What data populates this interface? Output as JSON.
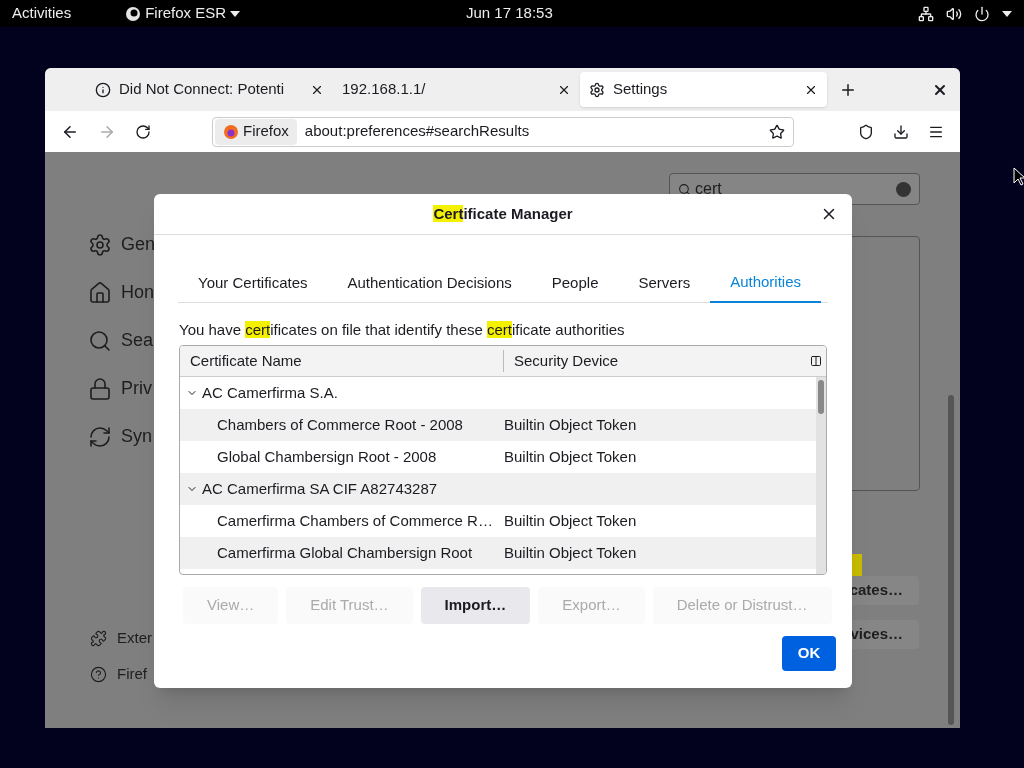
{
  "topbar": {
    "activities": "Activities",
    "app": "Firefox ESR",
    "clock": "Jun 17  18:53"
  },
  "browser": {
    "tabs": [
      {
        "title": "Did Not Connect: Potenti",
        "kind": "warning",
        "selected": false
      },
      {
        "title": "192.168.1.1/",
        "kind": "plain",
        "selected": false
      },
      {
        "title": "Settings",
        "kind": "settings",
        "selected": true
      }
    ],
    "identity": "Firefox",
    "url": "about:preferences#searchResults"
  },
  "settings": {
    "search": {
      "value": "cert"
    },
    "sidebar": [
      {
        "label": "Gen",
        "kind": "gear"
      },
      {
        "label": "Hon",
        "kind": "home"
      },
      {
        "label": "Sea",
        "kind": "search"
      },
      {
        "label": "Priv",
        "kind": "lock"
      },
      {
        "label": "Syn",
        "kind": "sync"
      }
    ],
    "footer": [
      {
        "label": "Exter",
        "kind": "puzzle"
      },
      {
        "label": "Firef",
        "kind": "help"
      }
    ],
    "buttons": [
      "cates…",
      "vices…"
    ]
  },
  "dialog": {
    "title": [
      {
        "text": "Cert",
        "highlight": true
      },
      {
        "text": "ificate Manager",
        "highlight": false
      }
    ],
    "tabs": [
      {
        "label": "Your Certificates",
        "selected": false
      },
      {
        "label": "Authentication Decisions",
        "selected": false
      },
      {
        "label": "People",
        "selected": false
      },
      {
        "label": "Servers",
        "selected": false
      },
      {
        "label": "Authorities",
        "selected": true
      }
    ],
    "description": [
      {
        "text": "You have ",
        "highlight": false
      },
      {
        "text": "cert",
        "highlight": true
      },
      {
        "text": "ificates on file that identify these ",
        "highlight": false
      },
      {
        "text": "cert",
        "highlight": true
      },
      {
        "text": "ificate authorities",
        "highlight": false
      }
    ],
    "columns": [
      "Certificate Name",
      "Security Device"
    ],
    "tree": [
      {
        "name": "AC Camerfirma S.A.",
        "expanded": true,
        "children": [
          {
            "name": "Chambers of Commerce Root - 2008",
            "device": "Builtin Object Token"
          },
          {
            "name": "Global Chambersign Root - 2008",
            "device": "Builtin Object Token"
          }
        ]
      },
      {
        "name": "AC Camerfirma SA CIF A82743287",
        "expanded": true,
        "children": [
          {
            "name": "Camerfirma Chambers of Commerce R…",
            "device": "Builtin Object Token"
          },
          {
            "name": "Camerfirma Global Chambersign Root",
            "device": "Builtin Object Token"
          }
        ]
      }
    ],
    "buttons": [
      {
        "label": "View…",
        "disabled": true
      },
      {
        "label": "Edit Trust…",
        "disabled": true
      },
      {
        "label": "Import…",
        "disabled": false
      },
      {
        "label": "Export…",
        "disabled": true
      },
      {
        "label": "Delete or Distrust…",
        "disabled": true
      }
    ],
    "ok": "OK"
  }
}
